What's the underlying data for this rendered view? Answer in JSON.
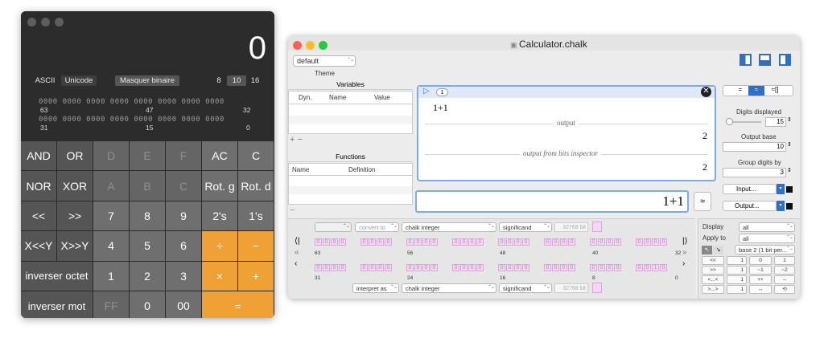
{
  "calc": {
    "display": "0",
    "ascii": "ASCII",
    "unicode": "Unicode",
    "mask": "Masquer binaire",
    "b8": "8",
    "b10": "10",
    "b16": "16",
    "bits_row1": "0000 0000 0000 0000 0000 0000 0000 0000",
    "bits_row2": "0000 0000 0000 0000 0000 0000 0000 0000",
    "n63": "63",
    "n47": "47",
    "n32": "32",
    "n31": "31",
    "n15": "15",
    "n0": "0",
    "keys": [
      [
        "AND",
        "OR",
        "D",
        "E",
        "F",
        "AC",
        "C"
      ],
      [
        "NOR",
        "XOR",
        "A",
        "B",
        "C",
        "Rot. g",
        "Rot. d"
      ],
      [
        "<<",
        ">>",
        "7",
        "8",
        "9",
        "2's",
        "1's"
      ],
      [
        "X<<Y",
        "X>>Y",
        "4",
        "5",
        "6",
        "÷",
        "−"
      ],
      [
        "inverser octet",
        "1",
        "2",
        "3",
        "×",
        "+"
      ],
      [
        "inverser mot",
        "FF",
        "0",
        "00",
        "="
      ]
    ]
  },
  "chalk": {
    "title": "Calculator.chalk",
    "theme_value": "default",
    "theme_label": "Theme",
    "variables": "Variables",
    "col_dyn": "Dyn.",
    "col_name": "Name",
    "col_value": "Value",
    "functions": "Functions",
    "fcol_name": "Name",
    "fcol_def": "Definition",
    "entry_num": "1",
    "input_expr": "1+1",
    "output_label": "output",
    "output_value": "2",
    "bits_label": "output from bits inspector",
    "bits_value": "2",
    "entry_input": "1+1",
    "approx": "≈",
    "seg": [
      "=",
      "≈",
      "≈[]"
    ],
    "digits_label": "Digits displayed",
    "digits_value": "15",
    "base_label": "Output base",
    "base_value": "10",
    "group_label": "Group digits by",
    "group_value": "3",
    "input_btn": "Input...",
    "output_btn": "Output...",
    "convert_to": "convert to",
    "chalk_integer": "chalk integer",
    "significand": "significand",
    "bit32768": "32768 bit",
    "interpret_as": "interpret as",
    "bitrow1": [
      "63",
      "56",
      "48",
      "40",
      "32"
    ],
    "bitrow2": [
      "31",
      "24",
      "16",
      "8",
      "0"
    ],
    "display_label": "Display",
    "display_value": "all",
    "applyto_label": "Apply to",
    "applyto_value": "all",
    "base2": "base 2 (1 bit per...",
    "shift_rows": [
      [
        "<<",
        "1",
        "0",
        "1"
      ],
      [
        ">>",
        "1",
        "~1",
        "~2"
      ],
      [
        "<...<",
        "1",
        "++",
        "--"
      ],
      [
        ">...>",
        "1",
        "↔",
        "⟲"
      ]
    ]
  }
}
